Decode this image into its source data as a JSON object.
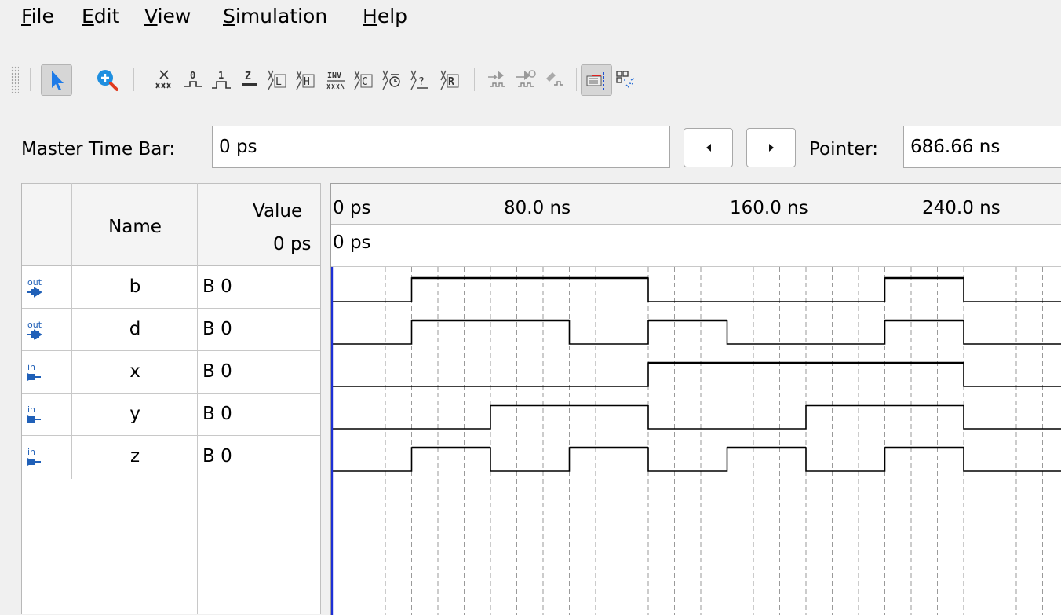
{
  "menu": [
    {
      "label": "File",
      "mnemonic": "F",
      "rest": "ile"
    },
    {
      "label": "Edit",
      "mnemonic": "E",
      "rest": "dit"
    },
    {
      "label": "View",
      "mnemonic": "V",
      "rest": "iew"
    },
    {
      "label": "Simulation",
      "mnemonic": "S",
      "rest": "imulation"
    },
    {
      "label": "Help",
      "mnemonic": "H",
      "rest": "elp"
    }
  ],
  "toolbar": {
    "buttons": [
      {
        "name": "selection-tool-icon",
        "active": true
      },
      {
        "name": "zoom-tool-icon"
      },
      {
        "name": "forcing-unknown-icon"
      },
      {
        "name": "forcing-low-icon"
      },
      {
        "name": "forcing-high-icon"
      },
      {
        "name": "high-impedance-icon"
      },
      {
        "name": "weak-low-icon"
      },
      {
        "name": "weak-high-icon"
      },
      {
        "name": "invert-icon"
      },
      {
        "name": "count-value-icon"
      },
      {
        "name": "clock-value-icon"
      },
      {
        "name": "arbitrary-value-icon"
      },
      {
        "name": "random-value-icon"
      },
      {
        "name": "run-functional-simulation-icon"
      },
      {
        "name": "run-timing-simulation-icon"
      },
      {
        "name": "generate-netlist-icon"
      },
      {
        "name": "snap-to-grid-icon",
        "active": true
      },
      {
        "name": "grid-settings-icon"
      }
    ]
  },
  "master_time_bar": {
    "label": "Master Time Bar:",
    "value": "0 ps"
  },
  "pointer": {
    "label": "Pointer:",
    "value": "686.66 ns"
  },
  "table": {
    "name_header": "Name",
    "value_header": "Value",
    "value_subheader": "0 ps",
    "rows": [
      {
        "type": "out",
        "name": "b",
        "value": "B 0"
      },
      {
        "type": "out",
        "name": "d",
        "value": "B 0"
      },
      {
        "type": "in",
        "name": "x",
        "value": "B 0"
      },
      {
        "type": "in",
        "name": "y",
        "value": "B 0"
      },
      {
        "type": "in",
        "name": "z",
        "value": "B 0"
      }
    ]
  },
  "ruler": {
    "labels": [
      "0 ps",
      "80.0 ns",
      "160.0 ns",
      "240.0 ns"
    ],
    "time_row_label": "0 ps"
  },
  "colors": {
    "cursor": "#1c2fd6",
    "in_icon": "#2060b8",
    "grid": "#9a9a9a"
  },
  "waveforms": {
    "unit": "ns",
    "signals": [
      {
        "name": "b",
        "transitions": [
          [
            0,
            0
          ],
          [
            30,
            1
          ],
          [
            120,
            0
          ],
          [
            210,
            1
          ],
          [
            240,
            0
          ]
        ]
      },
      {
        "name": "d",
        "transitions": [
          [
            0,
            0
          ],
          [
            30,
            1
          ],
          [
            90,
            0
          ],
          [
            120,
            1
          ],
          [
            150,
            0
          ],
          [
            210,
            1
          ],
          [
            240,
            0
          ]
        ]
      },
      {
        "name": "x",
        "transitions": [
          [
            0,
            0
          ],
          [
            120,
            1
          ],
          [
            240,
            0
          ]
        ]
      },
      {
        "name": "y",
        "transitions": [
          [
            0,
            0
          ],
          [
            60,
            1
          ],
          [
            120,
            0
          ],
          [
            180,
            1
          ],
          [
            240,
            0
          ]
        ]
      },
      {
        "name": "z",
        "transitions": [
          [
            0,
            0
          ],
          [
            30,
            1
          ],
          [
            60,
            0
          ],
          [
            90,
            1
          ],
          [
            120,
            0
          ],
          [
            150,
            1
          ],
          [
            180,
            0
          ],
          [
            210,
            1
          ],
          [
            240,
            0
          ]
        ]
      }
    ]
  }
}
